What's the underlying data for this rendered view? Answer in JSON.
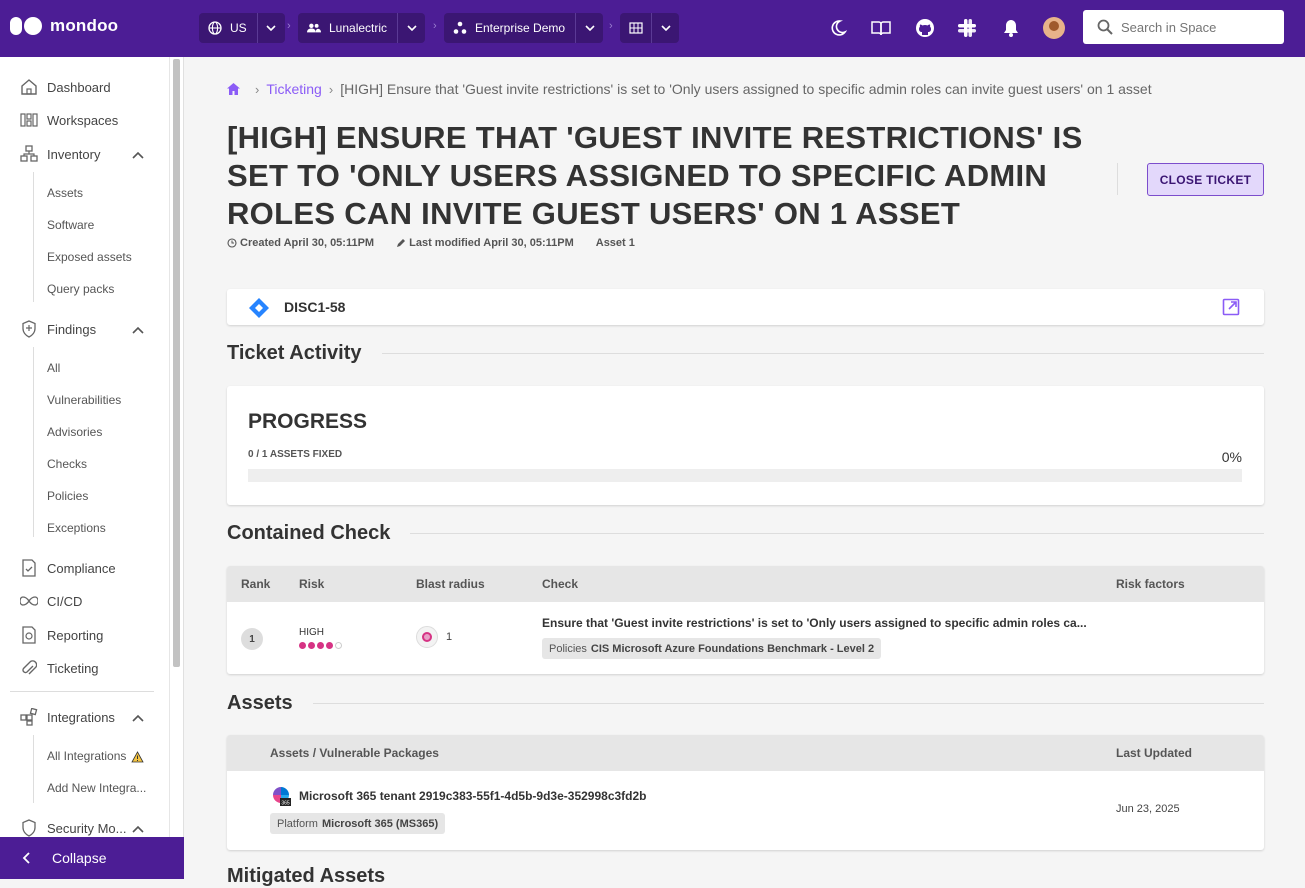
{
  "topbar": {
    "logo": "mondoo",
    "region": "US",
    "org": "Lunalectric",
    "space": "Enterprise Demo",
    "search_placeholder": "Search in Space"
  },
  "sidebar": {
    "dashboard": "Dashboard",
    "workspaces": "Workspaces",
    "inventory": "Inventory",
    "inventory_items": [
      "Assets",
      "Software",
      "Exposed assets",
      "Query packs"
    ],
    "findings": "Findings",
    "findings_items": [
      "All",
      "Vulnerabilities",
      "Advisories",
      "Checks",
      "Policies",
      "Exceptions"
    ],
    "compliance": "Compliance",
    "cicd": "CI/CD",
    "reporting": "Reporting",
    "ticketing": "Ticketing",
    "integrations": "Integrations",
    "integrations_items": [
      "All Integrations",
      "Add New Integra..."
    ],
    "security_model": "Security Mo...",
    "collapse": "Collapse"
  },
  "breadcrumb": {
    "parent": "Ticketing",
    "current": "[HIGH] Ensure that 'Guest invite restrictions' is set to 'Only users assigned to specific admin roles can invite guest users' on 1 asset"
  },
  "header": {
    "title": "[HIGH] ENSURE THAT 'GUEST INVITE RESTRICTIONS' IS SET TO 'ONLY USERS ASSIGNED TO SPECIFIC ADMIN ROLES CAN INVITE GUEST USERS' ON 1 ASSET",
    "close_button": "CLOSE TICKET",
    "created": "Created April 30, 05:11PM",
    "modified": "Last modified April 30, 05:11PM",
    "assets": "Asset 1"
  },
  "jira": {
    "key": "DISC1-58"
  },
  "activity": {
    "heading": "Ticket Activity",
    "progress_title": "PROGRESS",
    "progress_label": "0 / 1 ASSETS FIXED",
    "progress_percent": "0%",
    "progress_fraction": 0
  },
  "contained_check": {
    "heading": "Contained Check",
    "columns": {
      "rank": "Rank",
      "risk": "Risk",
      "blast": "Blast radius",
      "check": "Check",
      "factors": "Risk factors"
    },
    "row": {
      "rank": "1",
      "risk": "HIGH",
      "risk_level": 4,
      "blast": "1",
      "check": "Ensure that 'Guest invite restrictions' is set to 'Only users assigned to specific admin roles ca...",
      "tag_label": "Policies",
      "tag_value": "CIS Microsoft Azure Foundations Benchmark - Level 2"
    }
  },
  "assets": {
    "heading": "Assets",
    "columns": {
      "name": "Assets / Vulnerable Packages",
      "updated": "Last Updated"
    },
    "row": {
      "name": "Microsoft 365 tenant 2919c383-55f1-4d5b-9d3e-352998c3fd2b",
      "tag_label": "Platform",
      "tag_value": "Microsoft 365 (MS365)",
      "updated": "Jun 23, 2025"
    }
  },
  "mitigated": {
    "heading": "Mitigated Assets"
  },
  "colors": {
    "brand": "#4c1d95",
    "accent": "#8b5cf6",
    "risk_high": "#d63384"
  }
}
